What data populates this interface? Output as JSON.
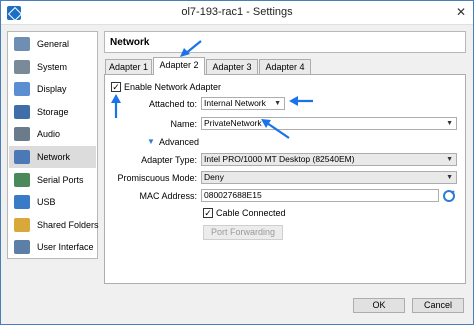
{
  "window": {
    "title": "ol7-193-rac1 - Settings",
    "close_glyph": "✕"
  },
  "sidebar": {
    "items": [
      {
        "label": "General",
        "icon": "general-icon",
        "color": "#6e8fb3"
      },
      {
        "label": "System",
        "icon": "system-icon",
        "color": "#7a8a99"
      },
      {
        "label": "Display",
        "icon": "display-icon",
        "color": "#5b8fd1"
      },
      {
        "label": "Storage",
        "icon": "storage-icon",
        "color": "#3f6ea8"
      },
      {
        "label": "Audio",
        "icon": "audio-icon",
        "color": "#6b7b8c"
      },
      {
        "label": "Network",
        "icon": "network-icon",
        "color": "#4b79b6",
        "selected": true
      },
      {
        "label": "Serial Ports",
        "icon": "serial-ports-icon",
        "color": "#4a8a5a"
      },
      {
        "label": "USB",
        "icon": "usb-icon",
        "color": "#3a7bc8"
      },
      {
        "label": "Shared Folders",
        "icon": "shared-folders-icon",
        "color": "#d8a93a"
      },
      {
        "label": "User Interface",
        "icon": "user-interface-icon",
        "color": "#5c7fa8"
      }
    ]
  },
  "header": {
    "title": "Network"
  },
  "tabs": [
    {
      "label": "Adapter 1"
    },
    {
      "label": "Adapter 2",
      "active": true
    },
    {
      "label": "Adapter 3"
    },
    {
      "label": "Adapter 4"
    }
  ],
  "adapter": {
    "enable_label": "Enable Network Adapter",
    "enable_checked": "✓",
    "attached_label": "Attached to:",
    "attached_value": "Internal Network",
    "name_label": "Name:",
    "name_value": "PrivateNetwork",
    "advanced_label": "Advanced",
    "advanced_glyph": "▼",
    "adapter_type_label": "Adapter Type:",
    "adapter_type_value": "Intel PRO/1000 MT Desktop (82540EM)",
    "promiscuous_label": "Promiscuous Mode:",
    "promiscuous_value": "Deny",
    "mac_label": "MAC Address:",
    "mac_value": "080027688E15",
    "cable_label": "Cable Connected",
    "cable_checked": "✓",
    "port_forwarding_label": "Port Forwarding",
    "dropdown_glyph": "▼"
  },
  "footer": {
    "ok_label": "OK",
    "cancel_label": "Cancel"
  },
  "colors": {
    "annotation_arrow": "#1a73e8",
    "accent": "#2c7cd6"
  }
}
